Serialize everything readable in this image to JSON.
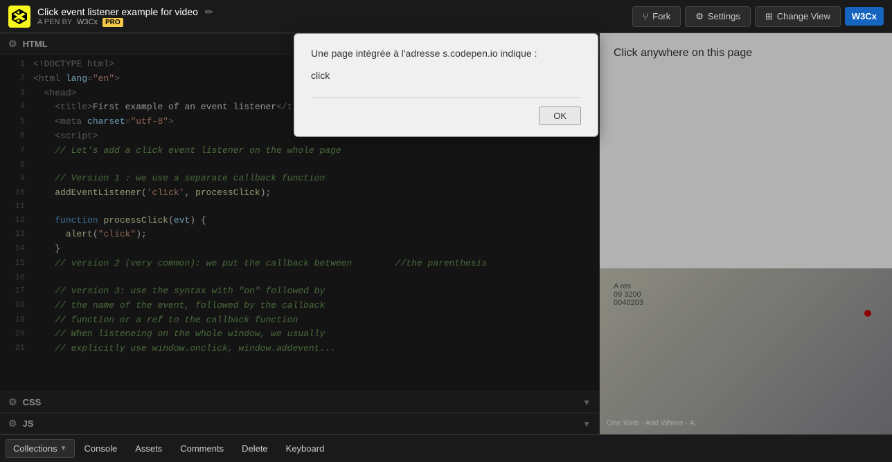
{
  "header": {
    "logo_text": "CP",
    "title": "Click event listener example for video",
    "edit_icon": "✏",
    "pen_label": "A PEN BY",
    "author": "W3Cx",
    "author_badge": "PRO",
    "fork_label": "Fork",
    "settings_label": "Settings",
    "change_view_label": "Change View",
    "w3cx_label": "W3Cx"
  },
  "editor": {
    "html_label": "HTML",
    "css_label": "CSS",
    "js_label": "JS",
    "lines": [
      {
        "num": "1",
        "content": "<!DOCTYPE html>"
      },
      {
        "num": "2",
        "content": "<html lang=\"en\">"
      },
      {
        "num": "3",
        "content": "  <head>"
      },
      {
        "num": "4",
        "content": "    <title>First example of an event listener</title>"
      },
      {
        "num": "5",
        "content": "    <meta charset=\"utf-8\">"
      },
      {
        "num": "6",
        "content": "    <script>"
      },
      {
        "num": "7",
        "content": "    // Let's add a click event listener on the whole page"
      },
      {
        "num": "8",
        "content": ""
      },
      {
        "num": "9",
        "content": "    // Version 1 : we use a separate callback function"
      },
      {
        "num": "10",
        "content": "    addEventListener('click', processClick);"
      },
      {
        "num": "11",
        "content": ""
      },
      {
        "num": "12",
        "content": "    function processClick(evt) {"
      },
      {
        "num": "13",
        "content": "      alert(\"click\");"
      },
      {
        "num": "14",
        "content": "    }"
      },
      {
        "num": "15",
        "content": "    // version 2 (very common): we put the callback between        //the parenthesis"
      },
      {
        "num": "16",
        "content": ""
      },
      {
        "num": "17",
        "content": "    // version 3: use the syntax with \"on\" followed by"
      },
      {
        "num": "18",
        "content": "    // the name of the event, followed by the callback"
      },
      {
        "num": "19",
        "content": "    // function or a ref to the callback function"
      },
      {
        "num": "20",
        "content": "    // When listeneing on the whole window, we usually"
      },
      {
        "num": "21",
        "content": "    // explicitly use window.onclick, window.addevent..."
      }
    ]
  },
  "dialog": {
    "title": "Une page intégrée à l'adresse s.codepen.io indique :",
    "message": "click",
    "ok_label": "OK"
  },
  "preview": {
    "text": "Click anywhere on this page"
  },
  "video": {
    "overlay_text": "One Web · And Where · A.",
    "watermark": ""
  },
  "toolbar": {
    "collections_label": "Collections",
    "console_label": "Console",
    "assets_label": "Assets",
    "comments_label": "Comments",
    "delete_label": "Delete",
    "keyboard_label": "Keyboard"
  }
}
